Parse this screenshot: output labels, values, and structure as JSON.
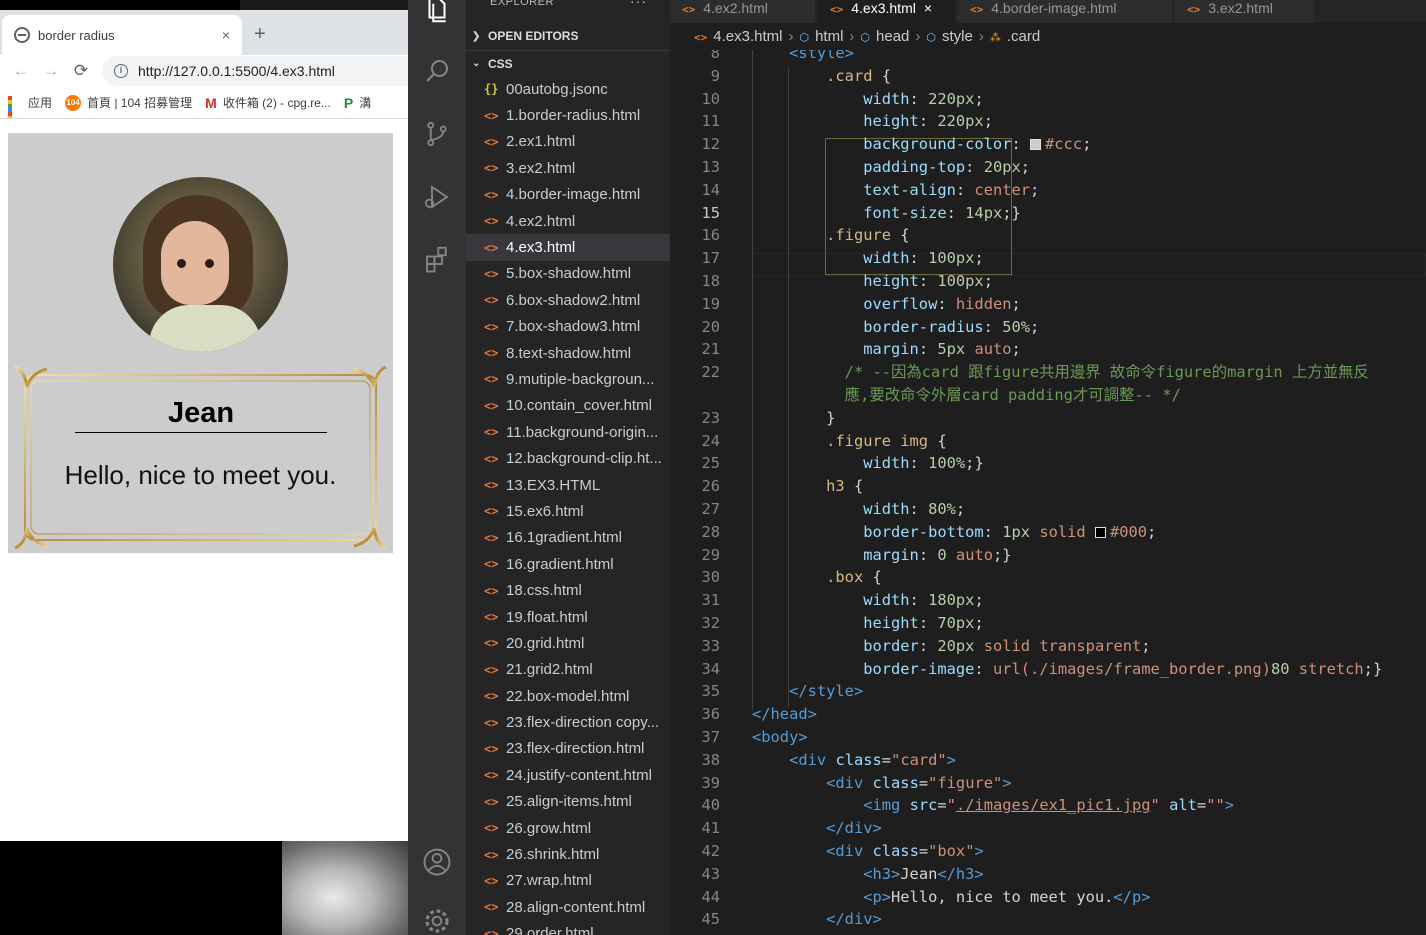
{
  "browser": {
    "tab_title": "border radius",
    "new_tab": "+",
    "close": "×",
    "url": "http://127.0.0.1:5500/4.ex3.html",
    "info_glyph": "i",
    "bookmarks": [
      {
        "label": "应用",
        "icon": "apps-icon"
      },
      {
        "label": "首頁 | 104 招募管理",
        "icon": "104-icon",
        "badge": "104"
      },
      {
        "label": "收件箱 (2) - cpg.re...",
        "icon": "gmail-icon",
        "badge": "M"
      },
      {
        "label": "溝",
        "icon": "bookmark-icon",
        "badge": "P"
      }
    ]
  },
  "page": {
    "name": "Jean",
    "greeting": "Hello, nice to meet you."
  },
  "vscode": {
    "explorer_title": "EXPLORER",
    "explorer_more": "···",
    "open_editors": "OPEN EDITORS",
    "folder": "CSS",
    "files": [
      {
        "name": "00autobg.jsonc",
        "type": "json",
        "glyph": "{}"
      },
      {
        "name": "1.border-radius.html",
        "type": "html",
        "glyph": "<>"
      },
      {
        "name": "2.ex1.html",
        "type": "html",
        "glyph": "<>"
      },
      {
        "name": "3.ex2.html",
        "type": "html",
        "glyph": "<>"
      },
      {
        "name": "4.border-image.html",
        "type": "html",
        "glyph": "<>"
      },
      {
        "name": "4.ex2.html",
        "type": "html",
        "glyph": "<>"
      },
      {
        "name": "4.ex3.html",
        "type": "html",
        "glyph": "<>",
        "active": true
      },
      {
        "name": "5.box-shadow.html",
        "type": "html",
        "glyph": "<>"
      },
      {
        "name": "6.box-shadow2.html",
        "type": "html",
        "glyph": "<>"
      },
      {
        "name": "7.box-shadow3.html",
        "type": "html",
        "glyph": "<>"
      },
      {
        "name": "8.text-shadow.html",
        "type": "html",
        "glyph": "<>"
      },
      {
        "name": "9.mutiple-backgroun...",
        "type": "html",
        "glyph": "<>"
      },
      {
        "name": "10.contain_cover.html",
        "type": "html",
        "glyph": "<>"
      },
      {
        "name": "11.background-origin...",
        "type": "html",
        "glyph": "<>"
      },
      {
        "name": "12.background-clip.ht...",
        "type": "html",
        "glyph": "<>"
      },
      {
        "name": "13.EX3.HTML",
        "type": "html",
        "glyph": "<>"
      },
      {
        "name": "15.ex6.html",
        "type": "html",
        "glyph": "<>"
      },
      {
        "name": "16.1gradient.html",
        "type": "html",
        "glyph": "<>"
      },
      {
        "name": "16.gradient.html",
        "type": "html",
        "glyph": "<>"
      },
      {
        "name": "18.css.html",
        "type": "html",
        "glyph": "<>"
      },
      {
        "name": "19.float.html",
        "type": "html",
        "glyph": "<>"
      },
      {
        "name": "20.grid.html",
        "type": "html",
        "glyph": "<>"
      },
      {
        "name": "21.grid2.html",
        "type": "html",
        "glyph": "<>"
      },
      {
        "name": "22.box-model.html",
        "type": "html",
        "glyph": "<>"
      },
      {
        "name": "23.flex-direction copy...",
        "type": "html",
        "glyph": "<>"
      },
      {
        "name": "23.flex-direction.html",
        "type": "html",
        "glyph": "<>"
      },
      {
        "name": "24.justify-content.html",
        "type": "html",
        "glyph": "<>"
      },
      {
        "name": "25.align-items.html",
        "type": "html",
        "glyph": "<>"
      },
      {
        "name": "26.grow.html",
        "type": "html",
        "glyph": "<>"
      },
      {
        "name": "26.shrink.html",
        "type": "html",
        "glyph": "<>"
      },
      {
        "name": "27.wrap.html",
        "type": "html",
        "glyph": "<>"
      },
      {
        "name": "28.align-content.html",
        "type": "html",
        "glyph": "<>"
      },
      {
        "name": "29.order.html",
        "type": "html",
        "glyph": "<>"
      }
    ],
    "tabs": [
      {
        "label": "4.ex2.html",
        "glyph": "<>"
      },
      {
        "label": "4.ex3.html",
        "glyph": "<>",
        "active": true,
        "close": "×"
      },
      {
        "label": "4.border-image.html",
        "glyph": "<>"
      },
      {
        "label": "3.ex2.html",
        "glyph": "<>"
      }
    ],
    "breadcrumbs": [
      {
        "label": "4.ex3.html",
        "glyph": "<>",
        "kind": "html"
      },
      {
        "label": "html",
        "glyph": "⬡",
        "kind": "cube"
      },
      {
        "label": "head",
        "glyph": "⬡",
        "kind": "cube"
      },
      {
        "label": "style",
        "glyph": "⬡",
        "kind": "cube"
      },
      {
        "label": ".card",
        "glyph": "⁂",
        "kind": "css"
      }
    ],
    "current_line": "15",
    "code_lines": [
      {
        "n": "8",
        "t": [
          [
            "    ",
            ""
          ],
          [
            "<style>",
            "tag"
          ]
        ]
      },
      {
        "n": "9",
        "t": [
          [
            "        ",
            ""
          ],
          [
            ".card",
            "sel"
          ],
          [
            " {",
            ""
          ]
        ]
      },
      {
        "n": "10",
        "t": [
          [
            "            ",
            ""
          ],
          [
            "width",
            "prop"
          ],
          [
            ": ",
            ""
          ],
          [
            "220px",
            "num"
          ],
          [
            ";",
            ""
          ]
        ]
      },
      {
        "n": "11",
        "t": [
          [
            "            ",
            ""
          ],
          [
            "height",
            "prop"
          ],
          [
            ": ",
            ""
          ],
          [
            "220px",
            "num"
          ],
          [
            ";",
            ""
          ]
        ]
      },
      {
        "n": "12",
        "t": [
          [
            "            ",
            ""
          ],
          [
            "background-color",
            "prop"
          ],
          [
            ": ",
            ""
          ],
          [
            "#ccc",
            "val",
            "#cccccc"
          ],
          [
            ";",
            ""
          ]
        ]
      },
      {
        "n": "13",
        "t": [
          [
            "            ",
            ""
          ],
          [
            "padding-top",
            "prop"
          ],
          [
            ": ",
            ""
          ],
          [
            "20px",
            "num"
          ],
          [
            ";",
            ""
          ]
        ]
      },
      {
        "n": "14",
        "t": [
          [
            "            ",
            ""
          ],
          [
            "text-align",
            "prop"
          ],
          [
            ": ",
            ""
          ],
          [
            "center",
            "val"
          ],
          [
            ";",
            ""
          ]
        ]
      },
      {
        "n": "15",
        "t": [
          [
            "            ",
            ""
          ],
          [
            "font-size",
            "prop"
          ],
          [
            ": ",
            ""
          ],
          [
            "14px",
            "num"
          ],
          [
            ";}",
            ""
          ]
        ]
      },
      {
        "n": "16",
        "t": [
          [
            "        ",
            ""
          ],
          [
            ".figure",
            "sel"
          ],
          [
            " {",
            ""
          ]
        ]
      },
      {
        "n": "17",
        "t": [
          [
            "            ",
            ""
          ],
          [
            "width",
            "prop"
          ],
          [
            ": ",
            ""
          ],
          [
            "100px",
            "num"
          ],
          [
            ";",
            ""
          ]
        ]
      },
      {
        "n": "18",
        "t": [
          [
            "            ",
            ""
          ],
          [
            "height",
            "prop"
          ],
          [
            ": ",
            ""
          ],
          [
            "100px",
            "num"
          ],
          [
            ";",
            ""
          ]
        ]
      },
      {
        "n": "19",
        "t": [
          [
            "            ",
            ""
          ],
          [
            "overflow",
            "prop"
          ],
          [
            ": ",
            ""
          ],
          [
            "hidden",
            "val"
          ],
          [
            ";",
            ""
          ]
        ]
      },
      {
        "n": "20",
        "t": [
          [
            "            ",
            ""
          ],
          [
            "border-radius",
            "prop"
          ],
          [
            ": ",
            ""
          ],
          [
            "50%",
            "num"
          ],
          [
            ";",
            ""
          ]
        ]
      },
      {
        "n": "21",
        "t": [
          [
            "            ",
            ""
          ],
          [
            "margin",
            "prop"
          ],
          [
            ": ",
            ""
          ],
          [
            "5px",
            "num"
          ],
          [
            " ",
            ""
          ],
          [
            "auto",
            "val"
          ],
          [
            ";",
            ""
          ]
        ]
      },
      {
        "n": "22",
        "t": [
          [
            "          ",
            ""
          ],
          [
            "/* --因為card 跟figure共用邊界 故命令figure的margin 上方並無反",
            "cmt"
          ]
        ]
      },
      {
        "n": "",
        "t": [
          [
            "          ",
            ""
          ],
          [
            "應,要改命令外層card padding才可調整-- */",
            "cmt"
          ]
        ]
      },
      {
        "n": "23",
        "t": [
          [
            "        }",
            ""
          ]
        ]
      },
      {
        "n": "24",
        "t": [
          [
            "        ",
            ""
          ],
          [
            ".figure img",
            "sel"
          ],
          [
            " {",
            ""
          ]
        ]
      },
      {
        "n": "25",
        "t": [
          [
            "            ",
            ""
          ],
          [
            "width",
            "prop"
          ],
          [
            ": ",
            ""
          ],
          [
            "100%",
            "num"
          ],
          [
            ";}",
            ""
          ]
        ]
      },
      {
        "n": "26",
        "t": [
          [
            "        ",
            ""
          ],
          [
            "h3",
            "sel"
          ],
          [
            " {",
            ""
          ]
        ]
      },
      {
        "n": "27",
        "t": [
          [
            "            ",
            ""
          ],
          [
            "width",
            "prop"
          ],
          [
            ": ",
            ""
          ],
          [
            "80%",
            "num"
          ],
          [
            ";",
            ""
          ]
        ]
      },
      {
        "n": "28",
        "t": [
          [
            "            ",
            ""
          ],
          [
            "border-bottom",
            "prop"
          ],
          [
            ": ",
            ""
          ],
          [
            "1px",
            "num"
          ],
          [
            " ",
            ""
          ],
          [
            "solid",
            "val"
          ],
          [
            " ",
            ""
          ],
          [
            "#000",
            "val",
            "#000000"
          ],
          [
            ";",
            ""
          ]
        ]
      },
      {
        "n": "29",
        "t": [
          [
            "            ",
            ""
          ],
          [
            "margin",
            "prop"
          ],
          [
            ": ",
            ""
          ],
          [
            "0",
            "num"
          ],
          [
            " ",
            ""
          ],
          [
            "auto",
            "val"
          ],
          [
            ";}",
            ""
          ]
        ]
      },
      {
        "n": "30",
        "t": [
          [
            "        ",
            ""
          ],
          [
            ".box",
            "sel"
          ],
          [
            " {",
            ""
          ]
        ]
      },
      {
        "n": "31",
        "t": [
          [
            "            ",
            ""
          ],
          [
            "width",
            "prop"
          ],
          [
            ": ",
            ""
          ],
          [
            "180px",
            "num"
          ],
          [
            ";",
            ""
          ]
        ]
      },
      {
        "n": "32",
        "t": [
          [
            "            ",
            ""
          ],
          [
            "height",
            "prop"
          ],
          [
            ": ",
            ""
          ],
          [
            "70px",
            "num"
          ],
          [
            ";",
            ""
          ]
        ]
      },
      {
        "n": "33",
        "t": [
          [
            "            ",
            ""
          ],
          [
            "border",
            "prop"
          ],
          [
            ": ",
            ""
          ],
          [
            "20px",
            "num"
          ],
          [
            " ",
            ""
          ],
          [
            "solid",
            "val"
          ],
          [
            " ",
            ""
          ],
          [
            "transparent",
            "val"
          ],
          [
            ";",
            ""
          ]
        ]
      },
      {
        "n": "34",
        "t": [
          [
            "            ",
            ""
          ],
          [
            "border-image",
            "prop"
          ],
          [
            ": ",
            ""
          ],
          [
            "url(",
            "val"
          ],
          [
            "./images/frame_border.png",
            "val"
          ],
          [
            ")",
            "val"
          ],
          [
            "80",
            "num"
          ],
          [
            " ",
            ""
          ],
          [
            "stretch",
            "val"
          ],
          [
            ";}",
            ""
          ]
        ]
      },
      {
        "n": "35",
        "t": [
          [
            "    ",
            ""
          ],
          [
            "</style>",
            "tag"
          ]
        ]
      },
      {
        "n": "36",
        "t": [
          [
            "",
            ""
          ],
          [
            "</head>",
            "tag"
          ]
        ]
      },
      {
        "n": "37",
        "t": [
          [
            "",
            ""
          ],
          [
            "<body>",
            "tag"
          ]
        ]
      },
      {
        "n": "38",
        "t": [
          [
            "    ",
            ""
          ],
          [
            "<div",
            "tag"
          ],
          [
            " ",
            ""
          ],
          [
            "class",
            "attr"
          ],
          [
            "=",
            ""
          ],
          [
            "\"card\"",
            "str"
          ],
          [
            ">",
            "tag"
          ]
        ]
      },
      {
        "n": "39",
        "t": [
          [
            "        ",
            ""
          ],
          [
            "<div",
            "tag"
          ],
          [
            " ",
            ""
          ],
          [
            "class",
            "attr"
          ],
          [
            "=",
            ""
          ],
          [
            "\"figure\"",
            "str"
          ],
          [
            ">",
            "tag"
          ]
        ]
      },
      {
        "n": "40",
        "t": [
          [
            "            ",
            ""
          ],
          [
            "<img",
            "tag"
          ],
          [
            " ",
            ""
          ],
          [
            "src",
            "attr"
          ],
          [
            "=",
            ""
          ],
          [
            "\"",
            "str"
          ],
          [
            "./images/ex1_pic1.jpg",
            "url"
          ],
          [
            "\"",
            "str"
          ],
          [
            " ",
            ""
          ],
          [
            "alt",
            "attr"
          ],
          [
            "=",
            ""
          ],
          [
            "\"\"",
            "str"
          ],
          [
            ">",
            "tag"
          ]
        ]
      },
      {
        "n": "41",
        "t": [
          [
            "        ",
            ""
          ],
          [
            "</div>",
            "tag"
          ]
        ]
      },
      {
        "n": "42",
        "t": [
          [
            "        ",
            ""
          ],
          [
            "<div",
            "tag"
          ],
          [
            " ",
            ""
          ],
          [
            "class",
            "attr"
          ],
          [
            "=",
            ""
          ],
          [
            "\"box\"",
            "str"
          ],
          [
            ">",
            "tag"
          ]
        ]
      },
      {
        "n": "43",
        "t": [
          [
            "            ",
            ""
          ],
          [
            "<h3>",
            "tag"
          ],
          [
            "Jean",
            ""
          ],
          [
            "</h3>",
            "tag"
          ]
        ]
      },
      {
        "n": "44",
        "t": [
          [
            "            ",
            ""
          ],
          [
            "<p>",
            "tag"
          ],
          [
            "Hello, nice to meet you.",
            ""
          ],
          [
            "</p>",
            "tag"
          ]
        ]
      },
      {
        "n": "45",
        "t": [
          [
            "        ",
            ""
          ],
          [
            "</div>",
            "tag"
          ]
        ]
      }
    ]
  }
}
